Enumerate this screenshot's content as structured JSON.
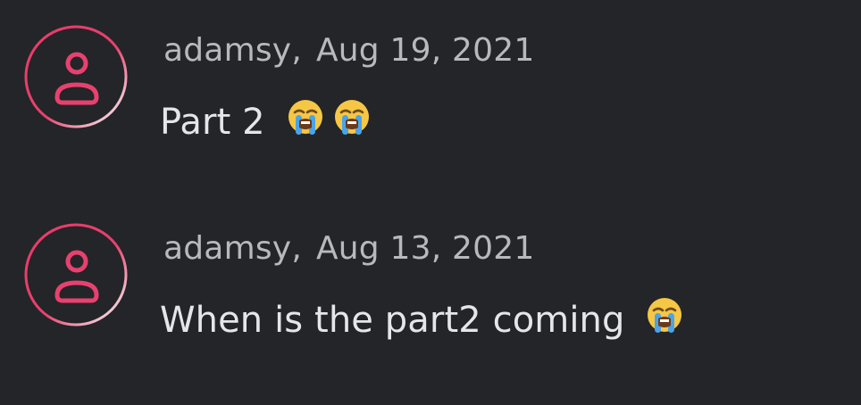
{
  "colors": {
    "background": "#232528",
    "accent": "#e8416f",
    "username_text": "#b9b9bd",
    "message_text": "#e6e6e8"
  },
  "comments": [
    {
      "author": "adamsy",
      "separator": ",",
      "date": "Aug 19, 2021",
      "text": "Part 2",
      "emojis": [
        "loudly-crying-face-icon",
        "loudly-crying-face-icon"
      ],
      "avatar_icon": "user-icon"
    },
    {
      "author": "adamsy",
      "separator": ",",
      "date": "Aug 13, 2021",
      "text": "When is the part2 coming",
      "emojis": [
        "loudly-crying-face-icon"
      ],
      "avatar_icon": "user-icon"
    }
  ]
}
